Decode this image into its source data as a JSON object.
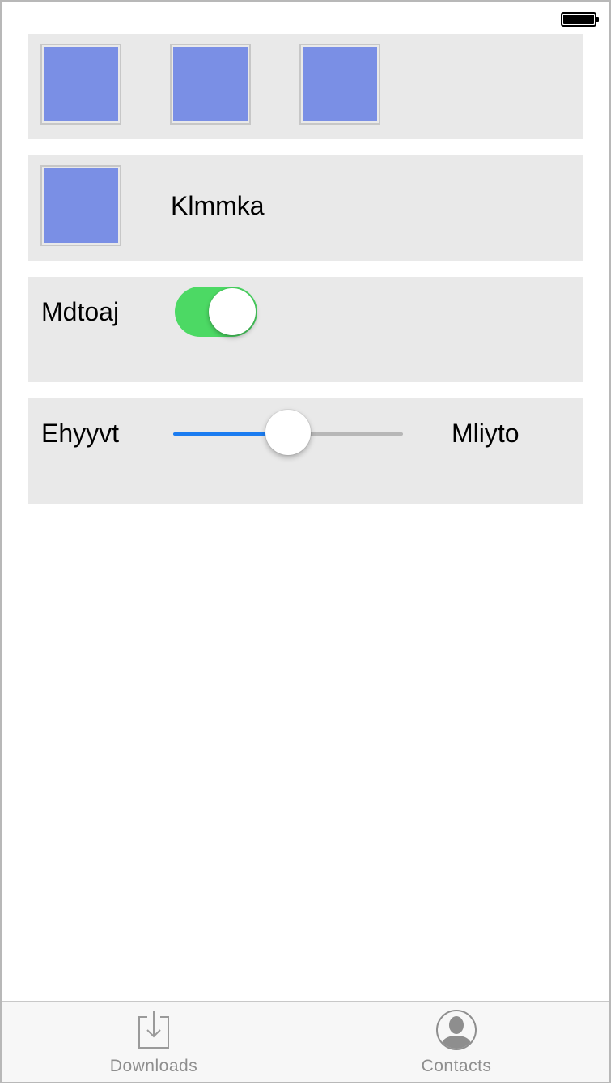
{
  "status_bar": {
    "battery_icon": "battery-full-icon"
  },
  "cells": [
    {
      "type": "image-row",
      "thumbnails": [
        "image-placeholder",
        "image-placeholder",
        "image-placeholder"
      ]
    },
    {
      "type": "image-with-label",
      "thumbnail": "image-placeholder",
      "label": "Klmmka"
    },
    {
      "type": "switch",
      "label": "Mdtoaj",
      "on": true
    },
    {
      "type": "slider",
      "min_label": "Ehyyvt",
      "max_label": "Mliyto",
      "value": 0.5
    }
  ],
  "tab_bar": {
    "items": [
      {
        "label": "Downloads",
        "icon": "download-icon"
      },
      {
        "label": "Contacts",
        "icon": "contact-icon"
      }
    ]
  },
  "colors": {
    "thumbnail_fill": "#7a8fe5",
    "cell_background": "#e9e9e9",
    "switch_on": "#4cd964",
    "slider_min_track": "#1b7cf0",
    "tab_label": "#8e8e8e"
  }
}
